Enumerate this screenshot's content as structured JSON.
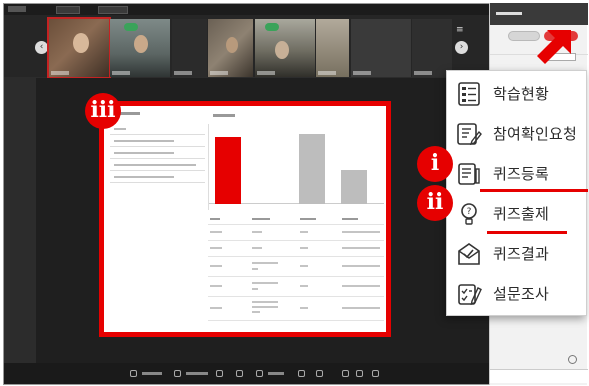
{
  "annotations": {
    "marker_iii": "iii",
    "marker_i": "i",
    "marker_ii": "ii"
  },
  "colors": {
    "highlight": "#e60000",
    "mic_badge": "#3aa35a",
    "sidebar_pill": "#e23a3a"
  },
  "menu": {
    "items": [
      {
        "label": "학습현황",
        "icon": "learning-status-icon"
      },
      {
        "label": "참여확인요청",
        "icon": "attendance-request-icon"
      },
      {
        "label": "퀴즈등록",
        "icon": "quiz-register-icon"
      },
      {
        "label": "퀴즈출제",
        "icon": "quiz-question-icon"
      },
      {
        "label": "퀴즈결과",
        "icon": "quiz-results-icon"
      },
      {
        "label": "설문조사",
        "icon": "survey-icon"
      }
    ]
  },
  "video_strip": {
    "tile_count": 8,
    "nav_icons": [
      "chevron-left-icon",
      "chevron-right-icon"
    ]
  },
  "slide": {
    "quiz_question_rows": 4,
    "table_rows": 5
  },
  "chart_data": {
    "type": "bar",
    "categories": [
      "",
      "",
      "",
      ""
    ],
    "values": [
      50,
      0,
      52,
      25
    ],
    "colors": [
      "#e60000",
      "#cccccc",
      "#bdbdbd",
      "#bdbdbd"
    ]
  }
}
